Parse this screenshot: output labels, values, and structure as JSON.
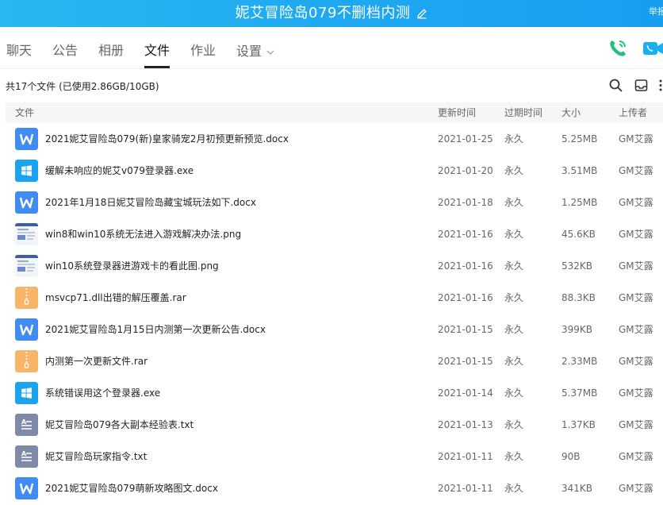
{
  "window": {
    "title": "妮艾冒险岛079不删档内测",
    "corner_text": "举报"
  },
  "tabs": [
    {
      "label": "聊天"
    },
    {
      "label": "公告"
    },
    {
      "label": "相册"
    },
    {
      "label": "文件",
      "active": true
    },
    {
      "label": "作业"
    },
    {
      "label": "设置"
    }
  ],
  "summary": "共17个文件 (已使用2.86GB/10GB)",
  "columns": {
    "name": "文件",
    "updated": "更新时间",
    "expires": "过期时间",
    "size": "大小",
    "uploader": "上传者"
  },
  "colors": {
    "titlebar": "#1ea9f2",
    "call_green": "#21c27a",
    "video_blue": "#1aaff0",
    "word": "#3f8cf4",
    "exe": "#1aa4f0",
    "rar": "#f8b56a",
    "txt": "#7e8aa8"
  },
  "files": [
    {
      "icon": "word-icon",
      "name": "2021妮艾冒险岛079(新)皇家骑宠2月初预更新预览.docx",
      "updated": "2021-01-25",
      "expires": "永久",
      "size": "5.25MB",
      "uploader": "GM艾露"
    },
    {
      "icon": "windows-exe-icon",
      "name": "缓解未响应的妮艾v079登录器.exe",
      "updated": "2021-01-20",
      "expires": "永久",
      "size": "3.51MB",
      "uploader": "GM艾露"
    },
    {
      "icon": "word-icon",
      "name": "2021年1月18日妮艾冒险岛藏宝城玩法如下.docx",
      "updated": "2021-01-18",
      "expires": "永久",
      "size": "1.25MB",
      "uploader": "GM艾露"
    },
    {
      "icon": "image-thumbnail-icon",
      "name": "win8和win10系统无法进入游戏解决办法.png",
      "updated": "2021-01-16",
      "expires": "永久",
      "size": "45.6KB",
      "uploader": "GM艾露"
    },
    {
      "icon": "image-thumbnail-icon",
      "name": "win10系统登录器进游戏卡的看此图.png",
      "updated": "2021-01-16",
      "expires": "永久",
      "size": "532KB",
      "uploader": "GM艾露"
    },
    {
      "icon": "archive-icon",
      "name": "msvcp71.dll出错的解压覆盖.rar",
      "updated": "2021-01-16",
      "expires": "永久",
      "size": "88.3KB",
      "uploader": "GM艾露"
    },
    {
      "icon": "word-icon",
      "name": "2021妮艾冒险岛1月15日内测第一次更新公告.docx",
      "updated": "2021-01-15",
      "expires": "永久",
      "size": "399KB",
      "uploader": "GM艾露"
    },
    {
      "icon": "archive-icon",
      "name": "内测第一次更新文件.rar",
      "updated": "2021-01-15",
      "expires": "永久",
      "size": "2.33MB",
      "uploader": "GM艾露"
    },
    {
      "icon": "windows-exe-icon",
      "name": "系统错误用这个登录器.exe",
      "updated": "2021-01-14",
      "expires": "永久",
      "size": "5.37MB",
      "uploader": "GM艾露"
    },
    {
      "icon": "text-file-icon",
      "name": "妮艾冒险岛079各大副本经验表.txt",
      "updated": "2021-01-13",
      "expires": "永久",
      "size": "1.37KB",
      "uploader": "GM艾露"
    },
    {
      "icon": "text-file-icon",
      "name": "妮艾冒险岛玩家指令.txt",
      "updated": "2021-01-11",
      "expires": "永久",
      "size": "90B",
      "uploader": "GM艾露"
    },
    {
      "icon": "word-icon",
      "name": "2021妮艾冒险岛079萌新攻略图文.docx",
      "updated": "2021-01-11",
      "expires": "永久",
      "size": "341KB",
      "uploader": "GM艾露"
    }
  ]
}
